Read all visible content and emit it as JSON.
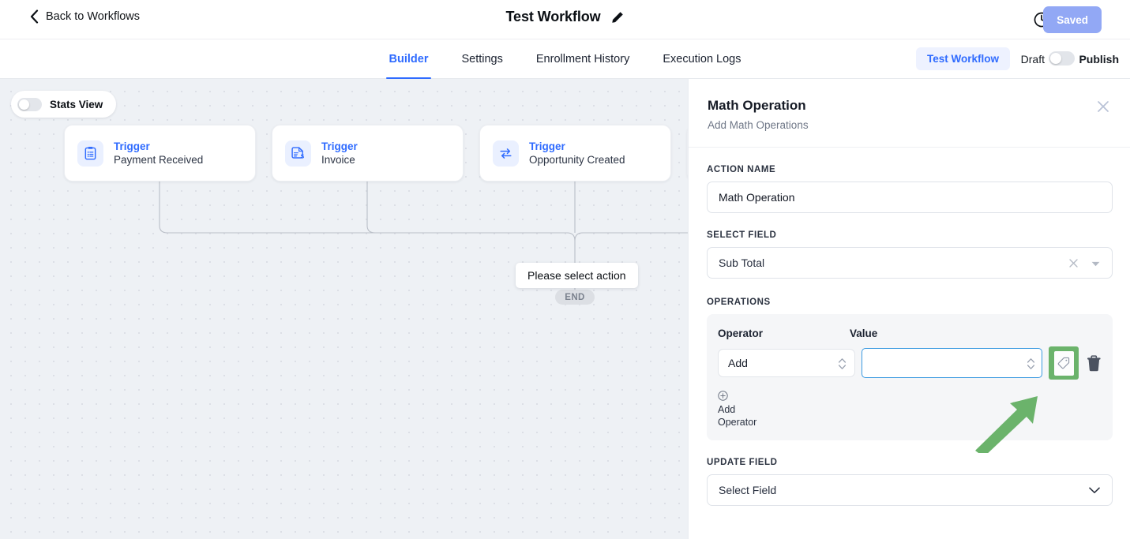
{
  "header": {
    "back_label": "Back to Workflows",
    "back_icon": "chevron-left-icon",
    "workflow_title": "Test Workflow",
    "edit_icon": "pencil-icon",
    "history_icon": "clock-history-icon",
    "save_label": "Saved"
  },
  "tabbar": {
    "tabs": [
      {
        "label": "Builder",
        "active": true
      },
      {
        "label": "Settings",
        "active": false
      },
      {
        "label": "Enrollment History",
        "active": false
      },
      {
        "label": "Execution Logs",
        "active": false
      }
    ],
    "test_workflow_label": "Test Workflow",
    "draft_label": "Draft",
    "publish_label": "Publish",
    "publish_toggle_state": "off"
  },
  "canvas": {
    "stats_view_label": "Stats View",
    "stats_view_toggle_state": "off",
    "nodes": [
      {
        "kind": "Trigger",
        "name": "Payment Received",
        "icon": "clipboard-icon"
      },
      {
        "kind": "Trigger",
        "name": "Invoice",
        "icon": "invoice-document-icon"
      },
      {
        "kind": "Trigger",
        "name": "Opportunity Created",
        "icon": "swap-arrows-icon"
      }
    ],
    "tooltip_text": "Please select action",
    "end_label": "END"
  },
  "panel": {
    "title": "Math Operation",
    "subtitle": "Add Math Operations",
    "close_icon": "close-icon",
    "action_name_label": "ACTION NAME",
    "action_name_value": "Math Operation",
    "action_name_placeholder": "Action Name",
    "select_field_label": "SELECT FIELD",
    "select_field_value": "Sub Total",
    "select_field_clear_icon": "clear-x-icon",
    "select_field_caret_icon": "caret-down-icon",
    "operations_label": "OPERATIONS",
    "operations": {
      "col_operator": "Operator",
      "col_value": "Value",
      "rows": [
        {
          "operator": "Add",
          "value": "",
          "value_placeholder": "",
          "tag_icon": "tag-icon",
          "delete_icon": "trash-icon"
        }
      ],
      "add_operator_icon": "plus-circle-icon",
      "add_operator_line1": "Add",
      "add_operator_line2": "Operator"
    },
    "update_field_label": "UPDATE FIELD",
    "update_field_value": "Select Field",
    "update_field_chevron_icon": "chevron-down-icon"
  },
  "annotation": {
    "highlight_color": "#6bb36b",
    "arrow_color": "#6bb36b",
    "target": "tag-icon"
  },
  "colors": {
    "accent_blue": "#2f6bff",
    "focus_blue": "#3b9ae1",
    "saved_button": "#92a8f5",
    "canvas_bg": "#eef1f5",
    "ops_panel_bg": "#f5f6f8"
  }
}
